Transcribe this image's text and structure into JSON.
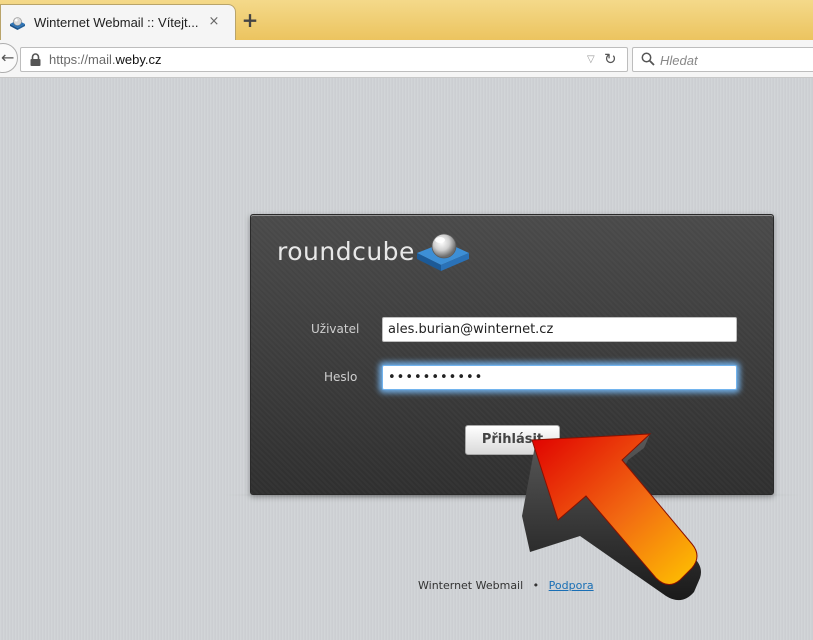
{
  "browser": {
    "tab_title": "Winternet Webmail :: Vítejt...",
    "tab_close": "×",
    "new_tab": "+",
    "url_prefix": "https://mail.",
    "url_host": "weby.cz",
    "search_placeholder": "Hledat"
  },
  "login": {
    "logo_text": "roundcube",
    "user_label": "Uživatel",
    "user_value": "ales.burian@winternet.cz",
    "pass_label": "Heslo",
    "pass_value": "ales-burian",
    "submit_label": "Přihlásit"
  },
  "footer": {
    "product": "Winternet Webmail",
    "separator": "•",
    "support_link": "Podpora"
  },
  "colors": {
    "accent": "#1a6fb5",
    "tabbar": "#ecc45f",
    "panel": "#3f3f3f",
    "arrow_start": "#e00000",
    "arrow_end": "#ffc400"
  }
}
